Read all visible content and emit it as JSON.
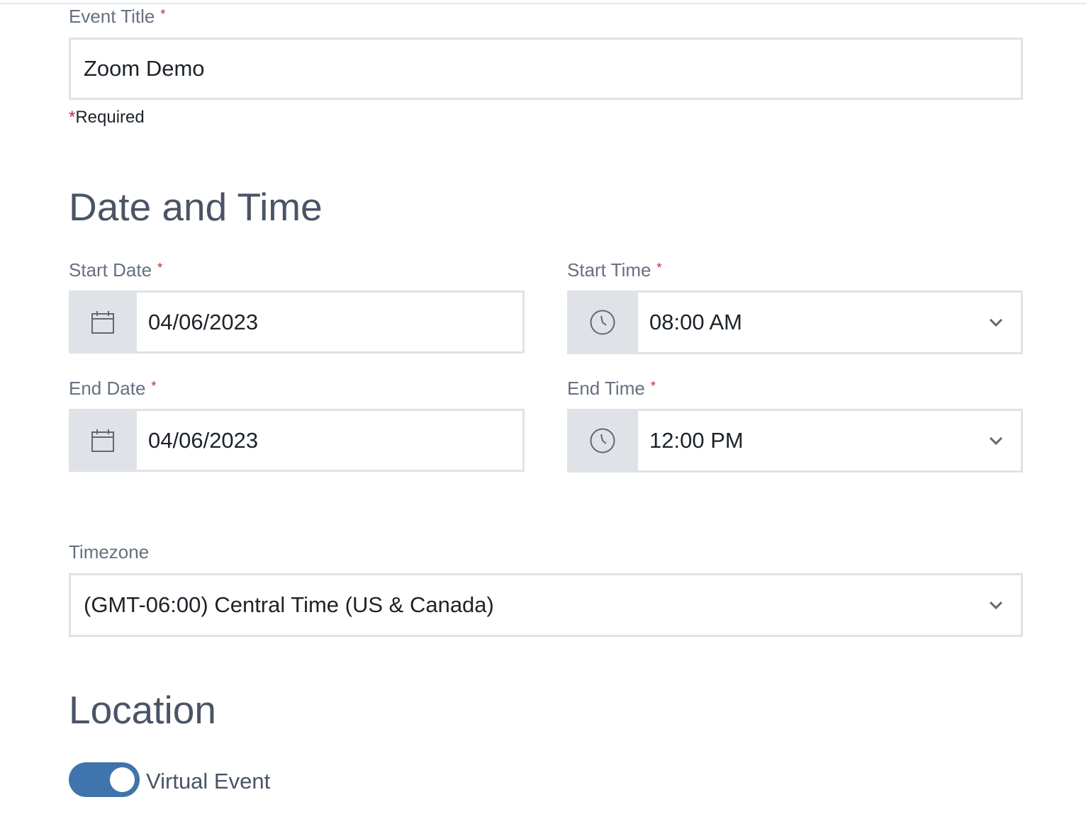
{
  "event_title": {
    "label": "Event Title",
    "value": "Zoom Demo",
    "required_marker": "*",
    "required_note": "Required"
  },
  "date_time": {
    "heading": "Date and Time",
    "start_date": {
      "label": "Start Date",
      "value": "04/06/2023",
      "icon": "calendar-icon"
    },
    "start_time": {
      "label": "Start Time",
      "value": "08:00 AM",
      "icon": "clock-icon"
    },
    "end_date": {
      "label": "End Date",
      "value": "04/06/2023",
      "icon": "calendar-icon"
    },
    "end_time": {
      "label": "End Time",
      "value": "12:00 PM",
      "icon": "clock-icon"
    },
    "timezone": {
      "label": "Timezone",
      "value": "(GMT-06:00) Central Time (US & Canada)"
    }
  },
  "location": {
    "heading": "Location",
    "virtual_event_label": "Virtual Event",
    "virtual_event_on": true
  },
  "colors": {
    "accent": "#3f74ac",
    "required": "#c2253a",
    "border": "#dfe3e7",
    "heading": "#4a5466"
  }
}
